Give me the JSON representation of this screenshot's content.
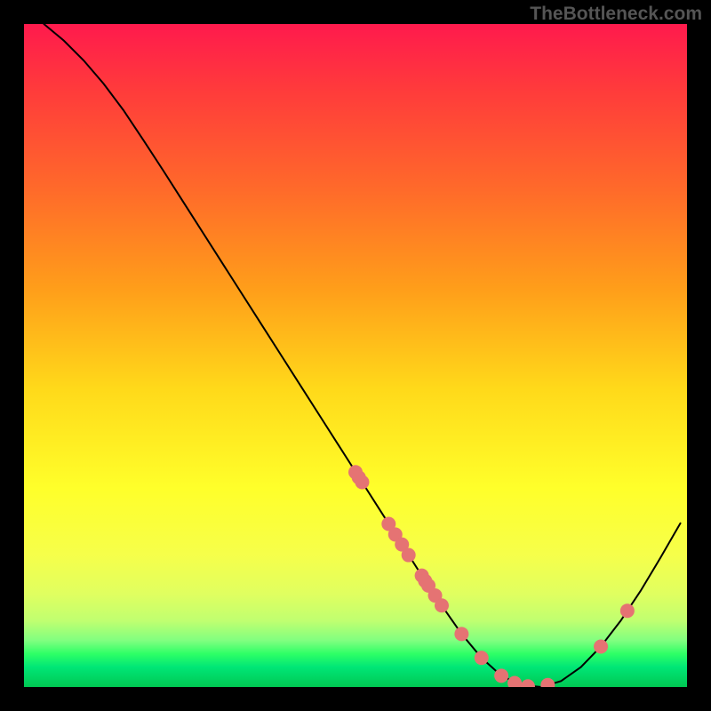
{
  "watermark": "TheBottleneck.com",
  "chart_data": {
    "type": "line",
    "title": "",
    "xlabel": "",
    "ylabel": "",
    "xlim": [
      0,
      100
    ],
    "ylim": [
      0,
      100
    ],
    "series": [
      {
        "name": "bottleneck-curve",
        "x": [
          3,
          6,
          9,
          12,
          15,
          18,
          21,
          24,
          27,
          30,
          33,
          36,
          39,
          42,
          45,
          48,
          51,
          54,
          57,
          60,
          63,
          66,
          69,
          72,
          75,
          78,
          81,
          84,
          87,
          90,
          93,
          96,
          99
        ],
        "y": [
          100,
          97.5,
          94.5,
          91,
          87,
          82.5,
          77.9,
          73.2,
          68.5,
          63.8,
          59.1,
          54.4,
          49.7,
          45,
          40.3,
          35.6,
          30.9,
          26.2,
          21.5,
          16.8,
          12.3,
          8.0,
          4.4,
          1.7,
          0.3,
          0.0,
          0.9,
          3.0,
          6.1,
          10.0,
          14.5,
          19.5,
          24.7
        ]
      }
    ],
    "markers": {
      "name": "data-points",
      "color": "#e57373",
      "radius_px": 8,
      "x": [
        50,
        50.5,
        51,
        55,
        56,
        57,
        58,
        60,
        60.5,
        61,
        62,
        63,
        66,
        69,
        72,
        74,
        76,
        79,
        87,
        91
      ],
      "y": [
        32.4,
        31.6,
        30.9,
        24.6,
        23.0,
        21.5,
        19.9,
        16.8,
        16.0,
        15.3,
        13.8,
        12.3,
        8.0,
        4.4,
        1.7,
        0.6,
        0.1,
        0.3,
        6.1,
        11.5
      ]
    }
  }
}
